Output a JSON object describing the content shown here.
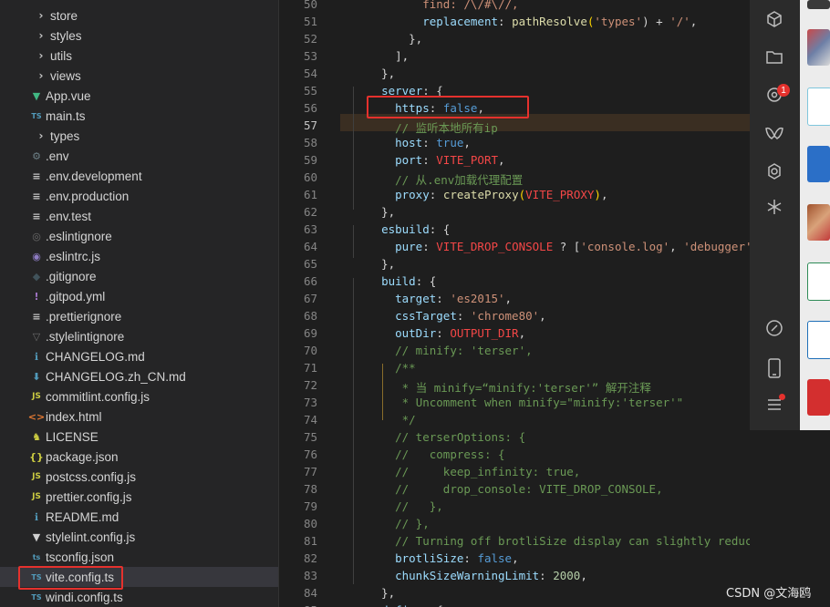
{
  "explorer": {
    "items": [
      {
        "label": "store",
        "icon": "chevron-right-icon",
        "type": "folder"
      },
      {
        "label": "styles",
        "icon": "chevron-right-icon",
        "type": "folder"
      },
      {
        "label": "utils",
        "icon": "chevron-right-icon",
        "type": "folder"
      },
      {
        "label": "views",
        "icon": "chevron-right-icon",
        "type": "folder"
      },
      {
        "label": "App.vue",
        "icon": "vue-file-icon",
        "type": "file"
      },
      {
        "label": "main.ts",
        "icon": "ts-file-icon",
        "type": "file"
      },
      {
        "label": "types",
        "icon": "chevron-right-icon",
        "type": "folder"
      },
      {
        "label": ".env",
        "icon": "gear-file-icon",
        "type": "file"
      },
      {
        "label": ".env.development",
        "icon": "lines-file-icon",
        "type": "file"
      },
      {
        "label": ".env.production",
        "icon": "lines-file-icon",
        "type": "file"
      },
      {
        "label": ".env.test",
        "icon": "lines-file-icon",
        "type": "file"
      },
      {
        "label": ".eslintignore",
        "icon": "eslint-ignore-icon",
        "type": "file"
      },
      {
        "label": ".eslintrc.js",
        "icon": "eslint-file-icon",
        "type": "file"
      },
      {
        "label": ".gitignore",
        "icon": "git-file-icon",
        "type": "file"
      },
      {
        "label": ".gitpod.yml",
        "icon": "yaml-file-icon",
        "type": "file"
      },
      {
        "label": ".prettierignore",
        "icon": "lines-file-icon",
        "type": "file"
      },
      {
        "label": ".stylelintignore",
        "icon": "stylelint-ignore-icon",
        "type": "file"
      },
      {
        "label": "CHANGELOG.md",
        "icon": "info-file-icon",
        "type": "file"
      },
      {
        "label": "CHANGELOG.zh_CN.md",
        "icon": "download-file-icon",
        "type": "file"
      },
      {
        "label": "commitlint.config.js",
        "icon": "js-file-icon",
        "type": "file"
      },
      {
        "label": "index.html",
        "icon": "html-file-icon",
        "type": "file"
      },
      {
        "label": "LICENSE",
        "icon": "license-file-icon",
        "type": "file"
      },
      {
        "label": "package.json",
        "icon": "json-file-icon",
        "type": "file"
      },
      {
        "label": "postcss.config.js",
        "icon": "js-file-icon",
        "type": "file"
      },
      {
        "label": "prettier.config.js",
        "icon": "js-file-icon",
        "type": "file"
      },
      {
        "label": "README.md",
        "icon": "info-file-icon",
        "type": "file"
      },
      {
        "label": "stylelint.config.js",
        "icon": "stylelint-file-icon",
        "type": "file"
      },
      {
        "label": "tsconfig.json",
        "icon": "tsconfig-file-icon",
        "type": "file"
      },
      {
        "label": "vite.config.ts",
        "icon": "ts-file-icon",
        "type": "file",
        "selected": true
      },
      {
        "label": "windi.config.ts",
        "icon": "ts-file-icon",
        "type": "file"
      }
    ]
  },
  "editor": {
    "active_line": 57,
    "lines": [
      {
        "n": "50",
        "t": [
          [
            "        ",
            ""
          ],
          [
            "find: /\\/#\\//,",
            "s"
          ]
        ]
      },
      {
        "n": "51",
        "t": [
          [
            "        ",
            ""
          ],
          [
            "replacement",
            "p"
          ],
          [
            ": ",
            ""
          ],
          [
            "pathResolve",
            "k"
          ],
          [
            "(",
            "g"
          ],
          [
            "'types'",
            "s"
          ],
          [
            ") + ",
            ""
          ],
          [
            "'/'",
            "s"
          ],
          [
            ",",
            ""
          ]
        ]
      },
      {
        "n": "52",
        "t": [
          [
            "      },",
            ""
          ]
        ]
      },
      {
        "n": "53",
        "t": [
          [
            "    ],",
            ""
          ]
        ]
      },
      {
        "n": "54",
        "t": [
          [
            "  },",
            ""
          ]
        ]
      },
      {
        "n": "55",
        "t": [
          [
            "  ",
            ""
          ],
          [
            "server",
            "p"
          ],
          [
            ": {",
            ""
          ]
        ]
      },
      {
        "n": "56",
        "t": [
          [
            "    ",
            ""
          ],
          [
            "https",
            "p"
          ],
          [
            ": ",
            ""
          ],
          [
            "false",
            "b"
          ],
          [
            ",",
            ""
          ]
        ]
      },
      {
        "n": "57",
        "t": [
          [
            "    ",
            ""
          ],
          [
            "// 监听本地所有ip",
            "c"
          ]
        ]
      },
      {
        "n": "58",
        "t": [
          [
            "    ",
            ""
          ],
          [
            "host",
            "p"
          ],
          [
            ": ",
            ""
          ],
          [
            "true",
            "b"
          ],
          [
            ",",
            ""
          ]
        ]
      },
      {
        "n": "59",
        "t": [
          [
            "    ",
            ""
          ],
          [
            "port",
            "p"
          ],
          [
            ": ",
            ""
          ],
          [
            "VITE_PORT",
            "v"
          ],
          [
            ",",
            ""
          ]
        ]
      },
      {
        "n": "60",
        "t": [
          [
            "    ",
            ""
          ],
          [
            "// 从.env加载代理配置",
            "c"
          ]
        ]
      },
      {
        "n": "61",
        "t": [
          [
            "    ",
            ""
          ],
          [
            "proxy",
            "p"
          ],
          [
            ": ",
            ""
          ],
          [
            "createProxy",
            "k"
          ],
          [
            "(",
            "g"
          ],
          [
            "VITE_PROXY",
            "v"
          ],
          [
            ")",
            "g"
          ],
          [
            ",",
            ""
          ]
        ]
      },
      {
        "n": "62",
        "t": [
          [
            "  },",
            ""
          ]
        ]
      },
      {
        "n": "63",
        "t": [
          [
            "  ",
            ""
          ],
          [
            "esbuild",
            "p"
          ],
          [
            ": {",
            ""
          ]
        ]
      },
      {
        "n": "64",
        "t": [
          [
            "    ",
            ""
          ],
          [
            "pure",
            "p"
          ],
          [
            ": ",
            ""
          ],
          [
            "VITE_DROP_CONSOLE",
            "v"
          ],
          [
            " ? [",
            ""
          ],
          [
            "'console.log'",
            "s"
          ],
          [
            ", ",
            ""
          ],
          [
            "'debugger'",
            "s"
          ],
          [
            "]",
            ""
          ]
        ]
      },
      {
        "n": "65",
        "t": [
          [
            "  },",
            ""
          ]
        ]
      },
      {
        "n": "66",
        "t": [
          [
            "  ",
            ""
          ],
          [
            "build",
            "p"
          ],
          [
            ": {",
            ""
          ]
        ]
      },
      {
        "n": "67",
        "t": [
          [
            "    ",
            ""
          ],
          [
            "target",
            "p"
          ],
          [
            ": ",
            ""
          ],
          [
            "'es2015'",
            "s"
          ],
          [
            ",",
            ""
          ]
        ]
      },
      {
        "n": "68",
        "t": [
          [
            "    ",
            ""
          ],
          [
            "cssTarget",
            "p"
          ],
          [
            ": ",
            ""
          ],
          [
            "'chrome80'",
            "s"
          ],
          [
            ",",
            ""
          ]
        ]
      },
      {
        "n": "69",
        "t": [
          [
            "    ",
            ""
          ],
          [
            "outDir",
            "p"
          ],
          [
            ": ",
            ""
          ],
          [
            "OUTPUT_DIR",
            "v"
          ],
          [
            ",",
            ""
          ]
        ]
      },
      {
        "n": "70",
        "t": [
          [
            "    ",
            ""
          ],
          [
            "// minify: 'terser',",
            "c"
          ]
        ]
      },
      {
        "n": "71",
        "t": [
          [
            "    ",
            ""
          ],
          [
            "/**",
            "c"
          ]
        ]
      },
      {
        "n": "72",
        "t": [
          [
            "     ",
            ""
          ],
          [
            "* 当 minify=“minify:'terser'” 解开注释",
            "c"
          ]
        ]
      },
      {
        "n": "73",
        "t": [
          [
            "     ",
            ""
          ],
          [
            "* Uncomment when minify=\"minify:'terser'\"",
            "c"
          ]
        ]
      },
      {
        "n": "74",
        "t": [
          [
            "     ",
            ""
          ],
          [
            "*/",
            "c"
          ]
        ]
      },
      {
        "n": "75",
        "t": [
          [
            "    ",
            ""
          ],
          [
            "// terserOptions: {",
            "c"
          ]
        ]
      },
      {
        "n": "76",
        "t": [
          [
            "    ",
            ""
          ],
          [
            "//   compress: {",
            "c"
          ]
        ]
      },
      {
        "n": "77",
        "t": [
          [
            "    ",
            ""
          ],
          [
            "//     keep_infinity: true,",
            "c"
          ]
        ]
      },
      {
        "n": "78",
        "t": [
          [
            "    ",
            ""
          ],
          [
            "//     drop_console: VITE_DROP_CONSOLE,",
            "c"
          ]
        ]
      },
      {
        "n": "79",
        "t": [
          [
            "    ",
            ""
          ],
          [
            "//   },",
            "c"
          ]
        ]
      },
      {
        "n": "80",
        "t": [
          [
            "    ",
            ""
          ],
          [
            "// },",
            "c"
          ]
        ]
      },
      {
        "n": "81",
        "t": [
          [
            "    ",
            ""
          ],
          [
            "// Turning off brotliSize display can slightly reduce packaging",
            "c"
          ]
        ]
      },
      {
        "n": "82",
        "t": [
          [
            "    ",
            ""
          ],
          [
            "brotliSize",
            "p"
          ],
          [
            ": ",
            ""
          ],
          [
            "false",
            "b"
          ],
          [
            ",",
            ""
          ]
        ]
      },
      {
        "n": "83",
        "t": [
          [
            "    ",
            ""
          ],
          [
            "chunkSizeWarningLimit",
            "p"
          ],
          [
            ": ",
            ""
          ],
          [
            "2000",
            "n"
          ],
          [
            ",",
            ""
          ]
        ]
      },
      {
        "n": "84",
        "t": [
          [
            "  },",
            ""
          ]
        ]
      },
      {
        "n": "85",
        "t": [
          [
            "  ",
            ""
          ],
          [
            "define",
            "p"
          ],
          [
            ": {",
            ""
          ]
        ]
      }
    ]
  },
  "panel": {
    "badge_count": "1",
    "icons": [
      "cube-icon",
      "folder-icon",
      "settings-badge-icon",
      "butterfly-icon",
      "gear-icon",
      "sparkle-icon",
      "link-icon",
      "phone-icon",
      "menu-icon"
    ]
  },
  "watermark": "CSDN @文海鸥",
  "colors": {
    "highlight": "#e5312d",
    "editor_bg": "#1e1e1e",
    "sidebar_bg": "#252526"
  }
}
